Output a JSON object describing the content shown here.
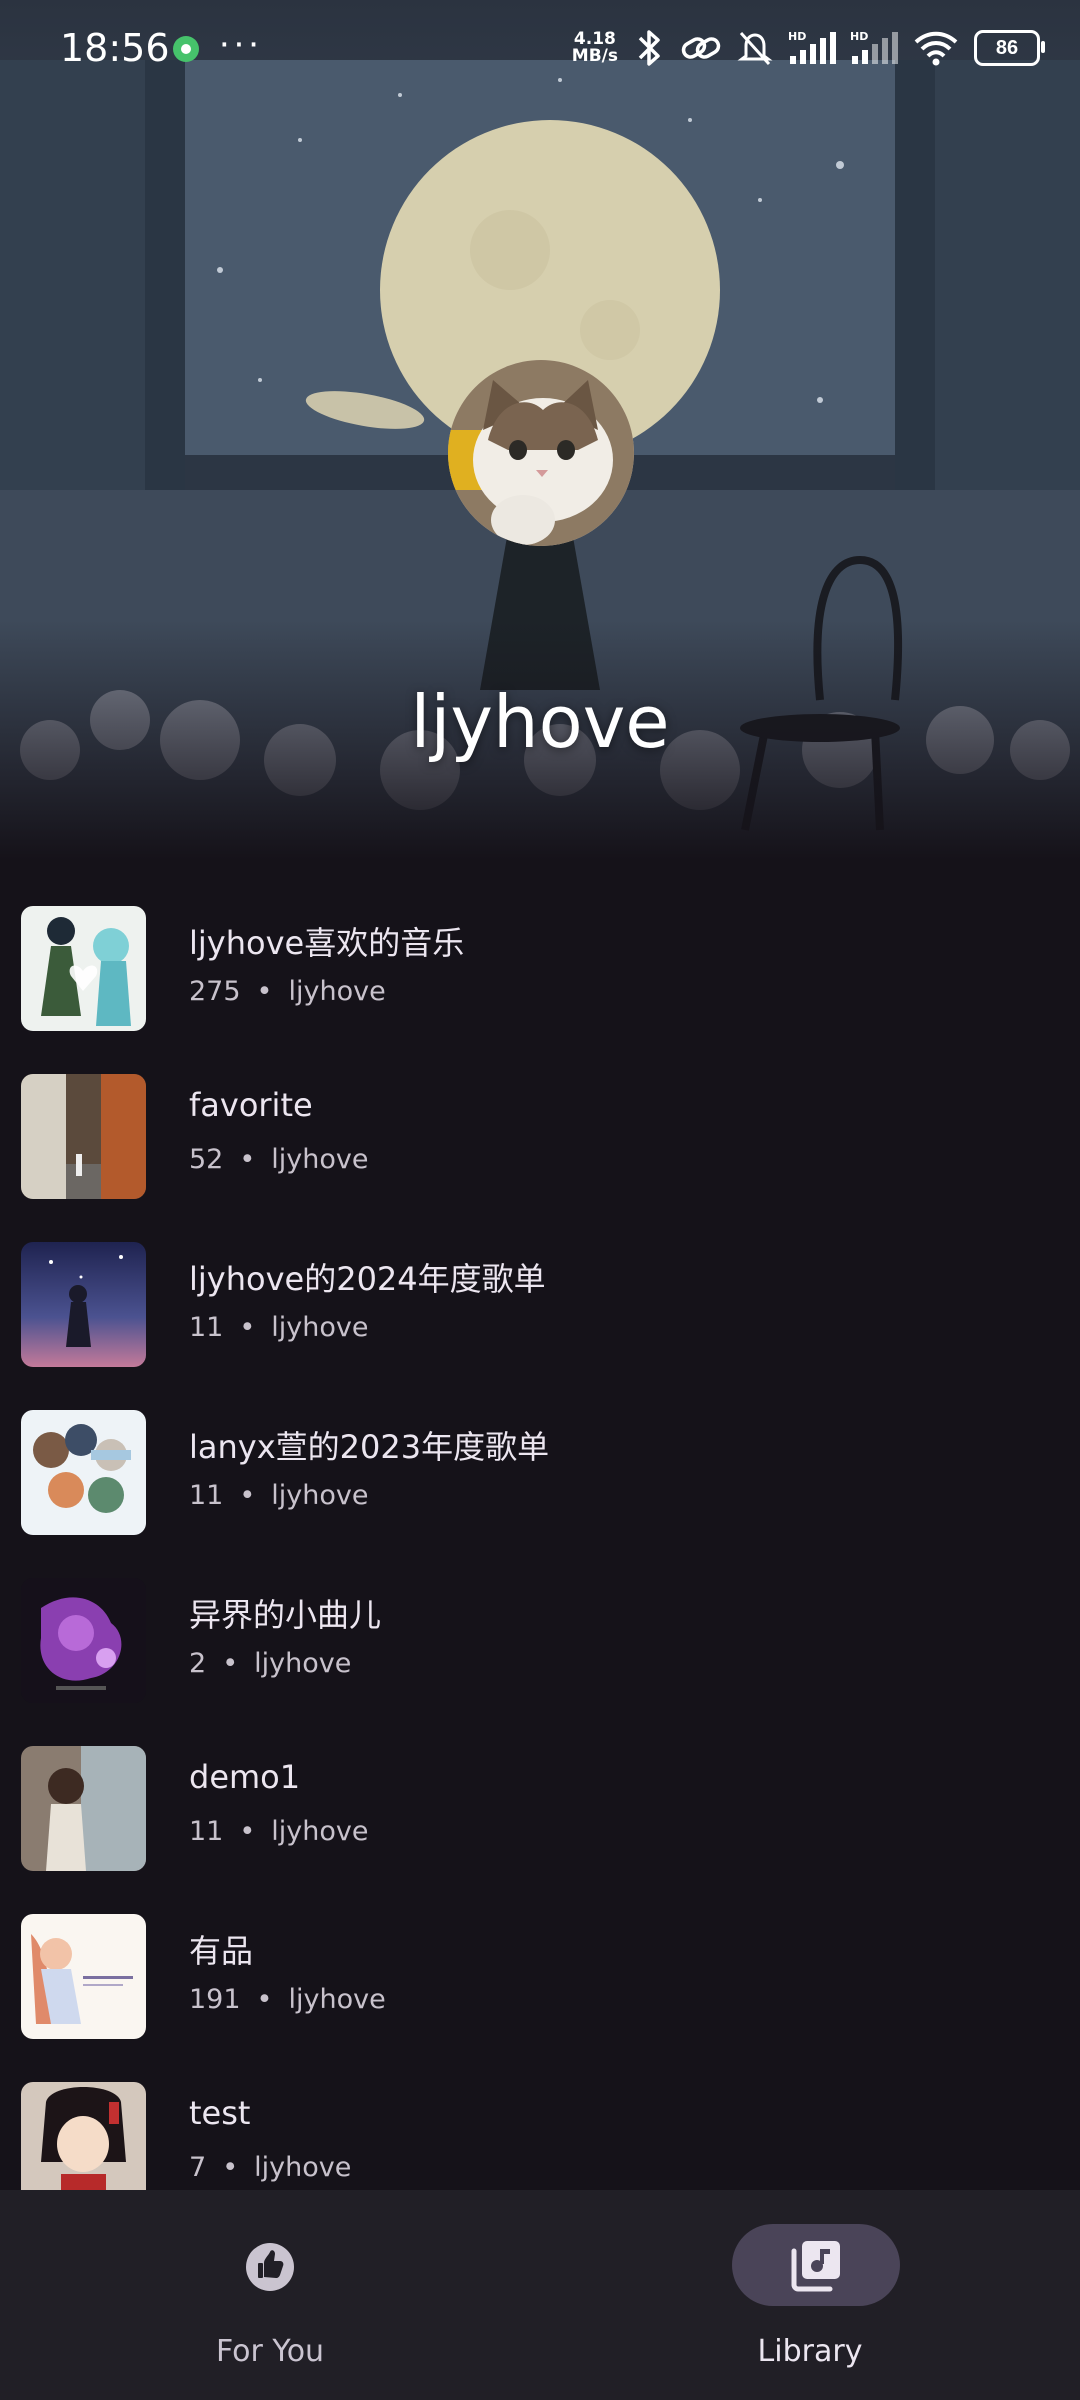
{
  "status_bar": {
    "time": "18:56",
    "more": "···",
    "net_speed_value": "4.18",
    "net_speed_unit": "MB/s",
    "battery": "86"
  },
  "profile": {
    "name": "ljyhove"
  },
  "playlists": [
    {
      "title": "ljyhove喜欢的音乐",
      "count": "275",
      "owner": "ljyhove"
    },
    {
      "title": "favorite",
      "count": "52",
      "owner": "ljyhove"
    },
    {
      "title": "ljyhove的2024年度歌单",
      "count": "11",
      "owner": "ljyhove"
    },
    {
      "title": "lanyx萱的2023年度歌单",
      "count": "11",
      "owner": "ljyhove"
    },
    {
      "title": "异界的小曲儿",
      "count": "2",
      "owner": "ljyhove"
    },
    {
      "title": "demo1",
      "count": "11",
      "owner": "ljyhove"
    },
    {
      "title": "有品",
      "count": "191",
      "owner": "ljyhove"
    },
    {
      "title": "test",
      "count": "7",
      "owner": "ljyhove"
    }
  ],
  "separator": "•",
  "bottom_nav": {
    "for_you_label": "For You",
    "library_label": "Library",
    "active": "library"
  },
  "colors": {
    "background": "#151219",
    "nav_background": "#211F26",
    "active_pill": "#4A4458"
  }
}
